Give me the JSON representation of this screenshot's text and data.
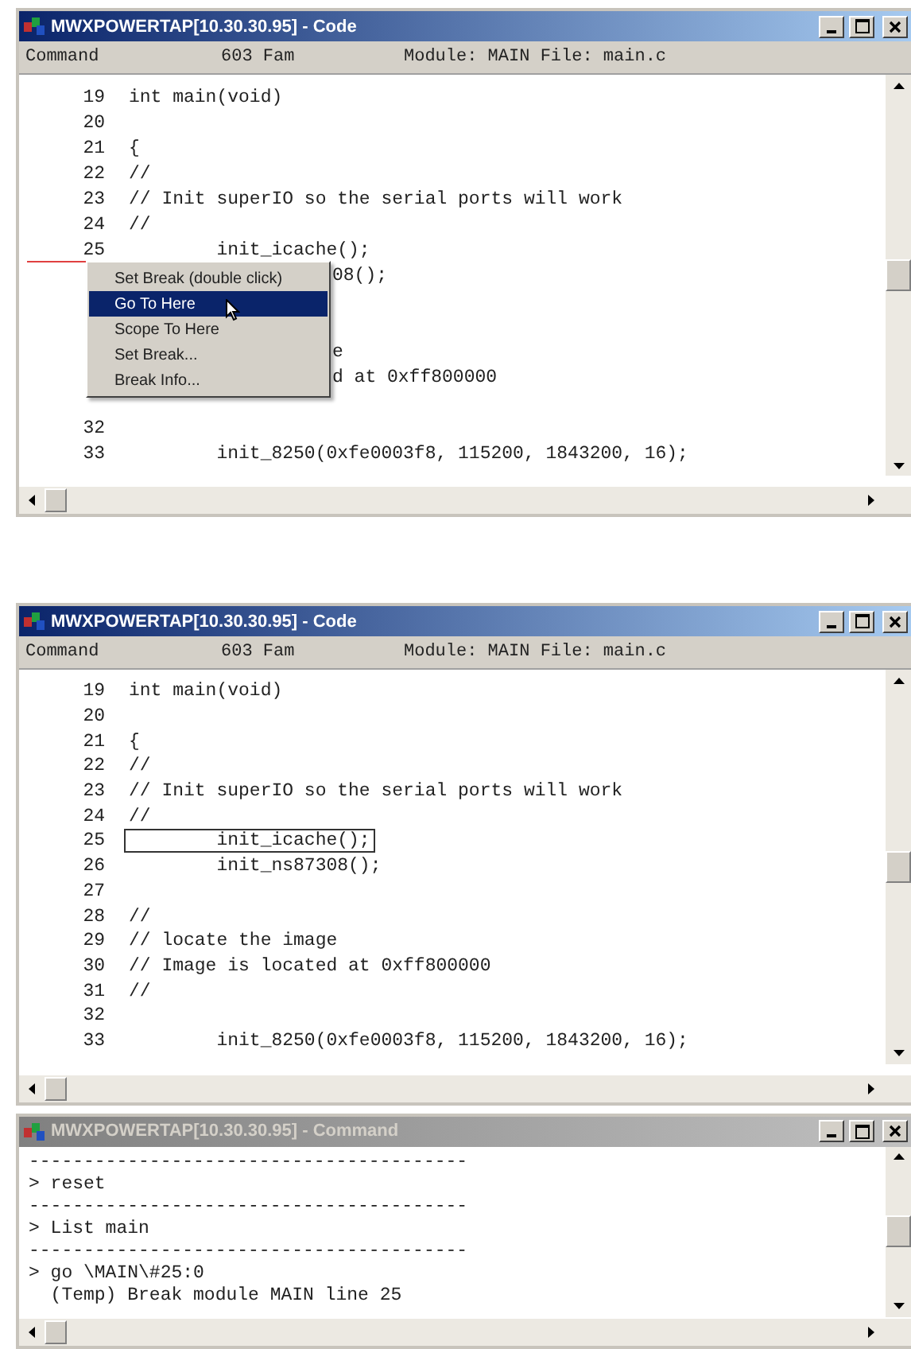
{
  "windows": [
    {
      "kind": "code",
      "title": "MWXPOWERTAP[10.30.30.95] - Code",
      "active": true,
      "header": {
        "command": "Command",
        "cpu": "603 Fam",
        "module": "Module: MAIN File: main.c"
      },
      "lines": [
        {
          "kind": "code",
          "number": "19",
          "text": "int main(void)"
        },
        {
          "kind": "code",
          "number": "20"
        },
        {
          "kind": "code",
          "number": "21",
          "text": "{"
        },
        {
          "kind": "code",
          "number": "22",
          "text": "//"
        },
        {
          "kind": "code",
          "number": "23",
          "text": "// Init superIO so the serial ports will work"
        },
        {
          "kind": "code",
          "number": "24",
          "text": "//"
        },
        {
          "kind": "code",
          "number": "25",
          "text": "        init_icache();",
          "break_marker": true
        },
        {
          "kind": "covered",
          "text": "08();"
        },
        {
          "kind": "covered"
        },
        {
          "kind": "covered"
        },
        {
          "kind": "covered",
          "text": "e"
        },
        {
          "kind": "covered",
          "text": "d at 0xff800000"
        },
        {
          "kind": "covered"
        },
        {
          "kind": "code",
          "number": "32"
        },
        {
          "kind": "code",
          "number": "33",
          "text": "        init_8250(0xfe0003f8, 115200, 1843200, 16);"
        }
      ],
      "context_menu": {
        "items": [
          {
            "label": "Set Break (double click)",
            "selected": false
          },
          {
            "label": "Go To Here",
            "selected": true
          },
          {
            "label": "Scope To Here",
            "selected": false
          },
          {
            "label": "Set Break...",
            "selected": false
          },
          {
            "label": "Break Info...",
            "selected": false
          }
        ]
      }
    },
    {
      "kind": "code",
      "title": "MWXPOWERTAP[10.30.30.95] - Code",
      "active": true,
      "header": {
        "command": "Command",
        "cpu": "603 Fam",
        "module": "Module: MAIN File: main.c"
      },
      "lines": [
        {
          "kind": "code",
          "number": "19",
          "text": "int main(void)"
        },
        {
          "kind": "code",
          "number": "20"
        },
        {
          "kind": "code",
          "number": "21",
          "text": "{"
        },
        {
          "kind": "code",
          "number": "22",
          "text": "//"
        },
        {
          "kind": "code",
          "number": "23",
          "text": "// Init superIO so the serial ports will work"
        },
        {
          "kind": "code",
          "number": "24",
          "text": "//"
        },
        {
          "kind": "code",
          "number": "25",
          "text": "        init_icache();",
          "current": true
        },
        {
          "kind": "code",
          "number": "26",
          "text": "        init_ns87308();"
        },
        {
          "kind": "code",
          "number": "27"
        },
        {
          "kind": "code",
          "number": "28",
          "text": "//"
        },
        {
          "kind": "code",
          "number": "29",
          "text": "// locate the image"
        },
        {
          "kind": "code",
          "number": "30",
          "text": "// Image is located at 0xff800000"
        },
        {
          "kind": "code",
          "number": "31",
          "text": "//"
        },
        {
          "kind": "code",
          "number": "32"
        },
        {
          "kind": "code",
          "number": "33",
          "text": "        init_8250(0xfe0003f8, 115200, 1843200, 16);"
        }
      ]
    },
    {
      "kind": "console",
      "title": "MWXPOWERTAP[10.30.30.95] - Command",
      "active": false,
      "lines": [
        {
          "text": "----------------------------------------"
        },
        {
          "text": "> reset"
        },
        {
          "text": "----------------------------------------"
        },
        {
          "text": "> List main"
        },
        {
          "text": "----------------------------------------"
        },
        {
          "text": "> go \\MAIN\\#25:0"
        },
        {
          "text": "  (Temp) Break module MAIN line 25"
        }
      ]
    }
  ]
}
